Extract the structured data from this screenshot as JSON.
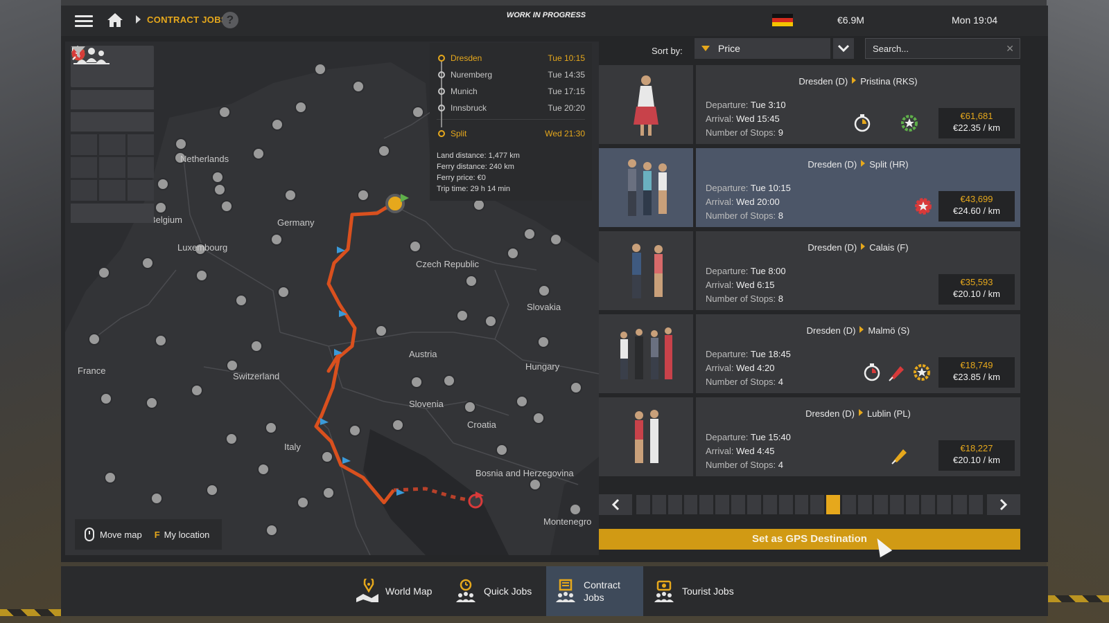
{
  "topbar": {
    "breadcrumb": "CONTRACT JOBS",
    "help": "?",
    "status": "WORK IN PROGRESS",
    "money": "€6.9M",
    "clock": "Mon 19:04"
  },
  "route_panel": {
    "stops": [
      {
        "city": "Dresden",
        "time": "Tue 10:15",
        "highlight": true
      },
      {
        "city": "Nuremberg",
        "time": "Tue 14:35",
        "highlight": false
      },
      {
        "city": "Munich",
        "time": "Tue 17:15",
        "highlight": false
      },
      {
        "city": "Innsbruck",
        "time": "Tue 20:20",
        "highlight": false
      },
      {
        "city": "Split",
        "time": "Wed 21:30",
        "highlight": true
      }
    ],
    "land_distance": "Land distance: 1,477 km",
    "ferry_distance": "Ferry distance: 240 km",
    "ferry_price": "Ferry price: €0",
    "trip_time": "Trip time: 29 h 14 min"
  },
  "map": {
    "labels": [
      "Netherlands",
      "Belgium",
      "Luxembourg",
      "Germany",
      "Czech Republic",
      "Slovakia",
      "Austria",
      "Hungary",
      "France",
      "Switzerland",
      "Slovenia",
      "Croatia",
      "Italy",
      "Bosnia and Herzegovina",
      "Montenegro"
    ],
    "hint_move": "Move map",
    "hint_key": "F",
    "hint_location": "My location"
  },
  "sort": {
    "label": "Sort by:",
    "value": "Price",
    "search_placeholder": "Search..."
  },
  "jobs": [
    {
      "from": "Dresden (D)",
      "to": "Pristina (RKS)",
      "departure": "Tue 3:10",
      "arrival": "Wed 15:45",
      "stops": "9",
      "price": "€61,681",
      "per_km": "€22.35 / km",
      "selected": false,
      "badges": [
        "timer-icon",
        "star-gear-icon"
      ]
    },
    {
      "from": "Dresden (D)",
      "to": "Split (HR)",
      "departure": "Tue 10:15",
      "arrival": "Wed 20:00",
      "stops": "8",
      "price": "€43,699",
      "per_km": "€24.60 / km",
      "selected": true,
      "badges": [
        "star-gear-icon"
      ]
    },
    {
      "from": "Dresden (D)",
      "to": "Calais (F)",
      "departure": "Tue 8:00",
      "arrival": "Wed 6:15",
      "stops": "8",
      "price": "€35,593",
      "per_km": "€20.10 / km",
      "selected": false,
      "badges": []
    },
    {
      "from": "Dresden (D)",
      "to": "Malmö (S)",
      "departure": "Tue 18:45",
      "arrival": "Wed 4:20",
      "stops": "4",
      "price": "€18,749",
      "per_km": "€23.85 / km",
      "selected": false,
      "badges": [
        "timer-icon",
        "fragile-icon",
        "star-gear-icon"
      ]
    },
    {
      "from": "Dresden (D)",
      "to": "Lublin (PL)",
      "departure": "Tue 15:40",
      "arrival": "Wed 4:45",
      "stops": "4",
      "price": "€18,227",
      "per_km": "€20.10 / km",
      "selected": false,
      "badges": [
        "fragile-icon"
      ]
    }
  ],
  "job_labels": {
    "departure": "Departure:",
    "arrival": "Arrival:",
    "stops": "Number of Stops:"
  },
  "pager": {
    "pages": 22,
    "current": 13
  },
  "gps_button": "Set as GPS Destination",
  "bottom_nav": [
    {
      "label": "World Map"
    },
    {
      "label": "Quick Jobs"
    },
    {
      "label_line1": "Contract",
      "label_line2": "Jobs"
    },
    {
      "label": "Tourist Jobs"
    }
  ],
  "colors": {
    "accent": "#e6a81c",
    "route": "#d9501e",
    "selected_row": "#4c5668",
    "danger": "#d83a3a",
    "safe": "#5fb04a"
  }
}
